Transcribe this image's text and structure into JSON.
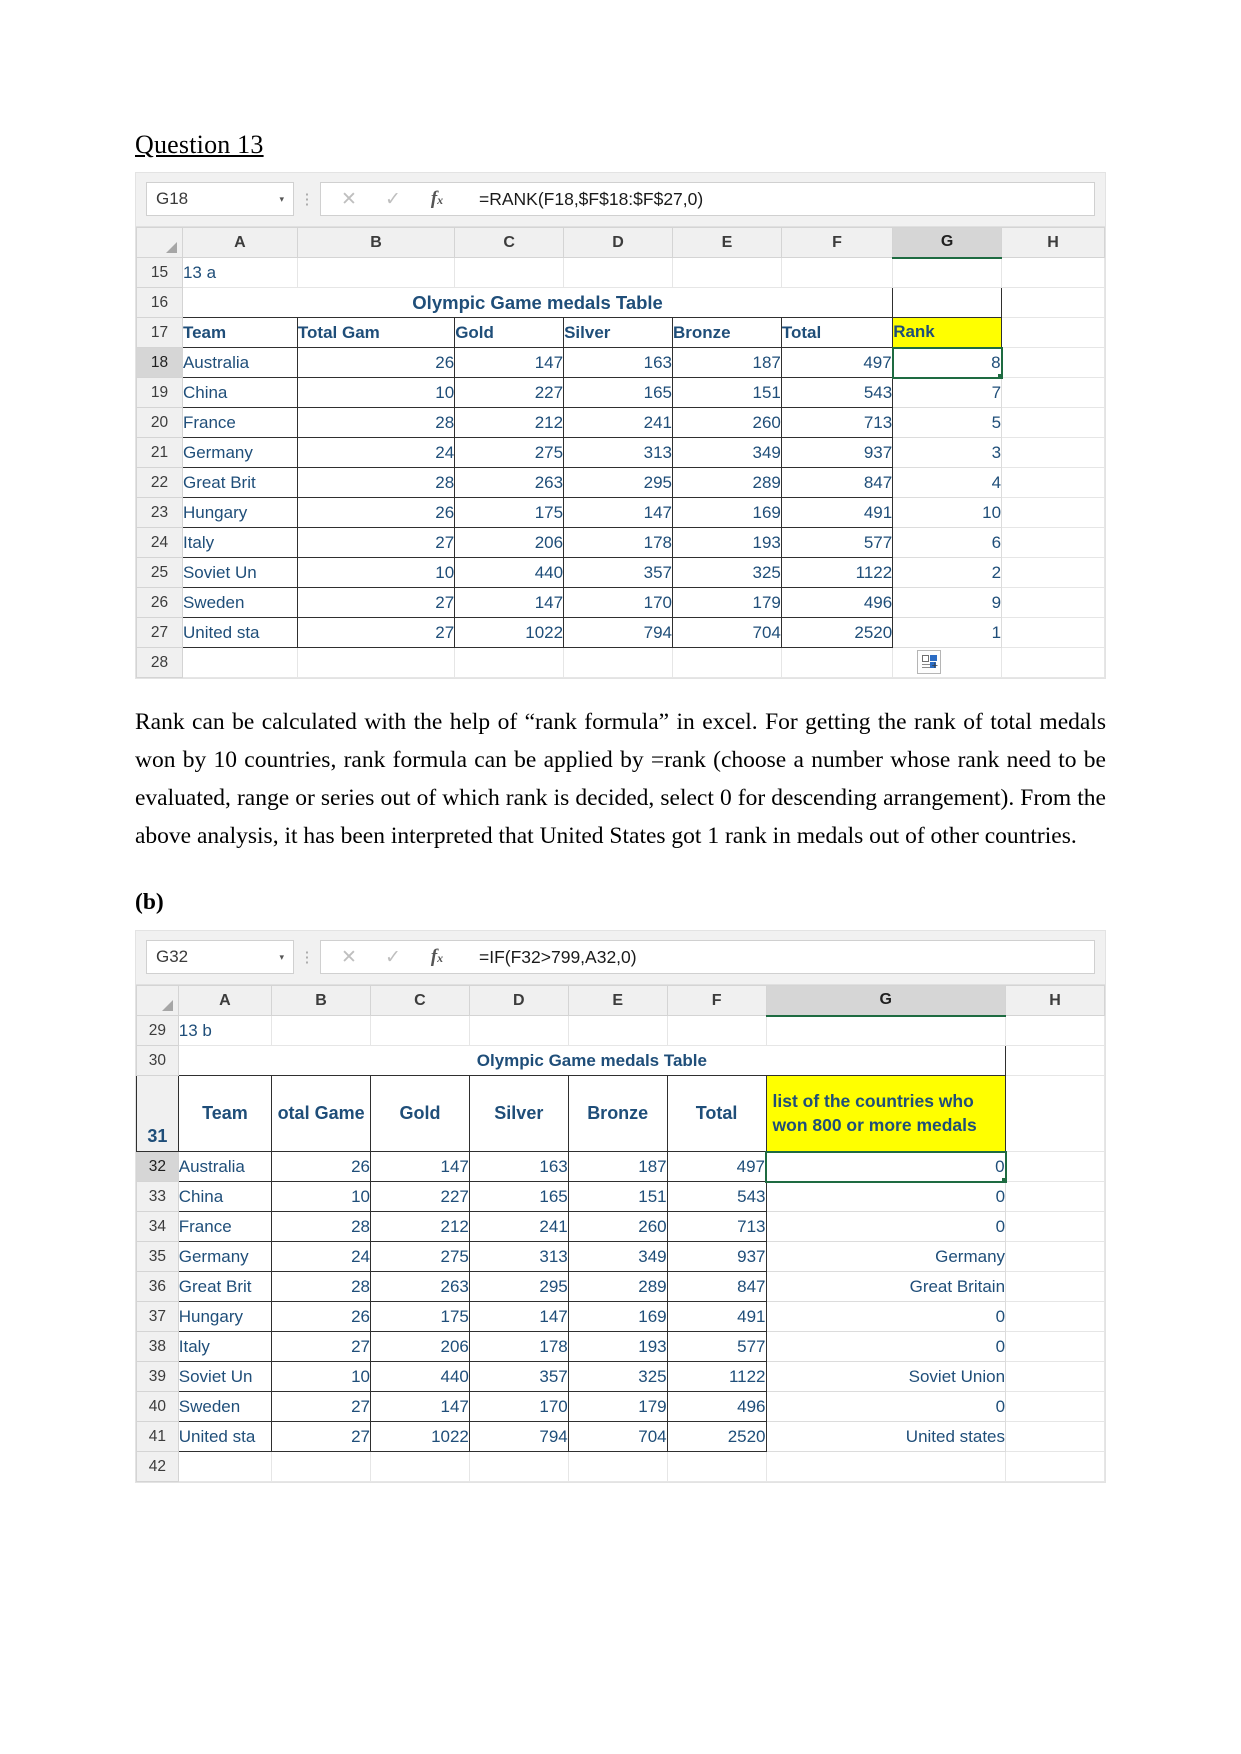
{
  "question_title": "Question 13",
  "sheet1": {
    "namebox": "G18",
    "namebox_caret": "▾",
    "menu_dots": "⋮",
    "cancel_icon": "✕",
    "confirm_icon": "✓",
    "fx_icon": "f",
    "fx_sub": "x",
    "formula": "=RANK(F18,$F$18:$F$27,0)",
    "columns": [
      "A",
      "B",
      "C",
      "D",
      "E",
      "F",
      "G",
      "H"
    ],
    "selected_column": "G",
    "rows": [
      "15",
      "16",
      "17",
      "18",
      "19",
      "20",
      "21",
      "22",
      "23",
      "24",
      "25",
      "26",
      "27",
      "28"
    ],
    "active_row": "18",
    "label_cell": "13 a",
    "table_title": "Olympic Game medals Table",
    "headers": [
      "Team",
      "Total Gam",
      "Gold",
      "Silver",
      "Bronze",
      "Total",
      "Rank"
    ],
    "highlight_header": "Rank",
    "data": [
      {
        "row": "18",
        "team": "Australia",
        "games": "26",
        "gold": "147",
        "silver": "163",
        "bronze": "187",
        "total": "497",
        "rank": "8"
      },
      {
        "row": "19",
        "team": "China",
        "games": "10",
        "gold": "227",
        "silver": "165",
        "bronze": "151",
        "total": "543",
        "rank": "7"
      },
      {
        "row": "20",
        "team": "France",
        "games": "28",
        "gold": "212",
        "silver": "241",
        "bronze": "260",
        "total": "713",
        "rank": "5"
      },
      {
        "row": "21",
        "team": "Germany",
        "games": "24",
        "gold": "275",
        "silver": "313",
        "bronze": "349",
        "total": "937",
        "rank": "3"
      },
      {
        "row": "22",
        "team": "Great Brit",
        "games": "28",
        "gold": "263",
        "silver": "295",
        "bronze": "289",
        "total": "847",
        "rank": "4"
      },
      {
        "row": "23",
        "team": "Hungary",
        "games": "26",
        "gold": "175",
        "silver": "147",
        "bronze": "169",
        "total": "491",
        "rank": "10"
      },
      {
        "row": "24",
        "team": "Italy",
        "games": "27",
        "gold": "206",
        "silver": "178",
        "bronze": "193",
        "total": "577",
        "rank": "6"
      },
      {
        "row": "25",
        "team": "Soviet Un",
        "games": "10",
        "gold": "440",
        "silver": "357",
        "bronze": "325",
        "total": "1122",
        "rank": "2"
      },
      {
        "row": "26",
        "team": "Sweden",
        "games": "27",
        "gold": "147",
        "silver": "170",
        "bronze": "179",
        "total": "496",
        "rank": "9"
      },
      {
        "row": "27",
        "team": "United sta",
        "games": "27",
        "gold": "1022",
        "silver": "794",
        "bronze": "704",
        "total": "2520",
        "rank": "1"
      }
    ],
    "last_row": "28",
    "autofill_plus": "+"
  },
  "paragraph": "Rank can be calculated with the help of “rank formula” in excel. For getting the rank of total medals won by 10 countries, rank formula can be applied by =rank (choose a number whose rank need to be evaluated, range or series out of which rank is decided, select 0 for descending arrangement). From the above analysis, it has been interpreted that United States got 1 rank in medals out of other countries.",
  "section_b_label": "(b)",
  "sheet2": {
    "namebox": "G32",
    "namebox_caret": "▾",
    "menu_dots": "⋮",
    "cancel_icon": "✕",
    "confirm_icon": "✓",
    "fx_icon": "f",
    "fx_sub": "x",
    "formula": "=IF(F32>799,A32,0)",
    "columns": [
      "A",
      "B",
      "C",
      "D",
      "E",
      "F",
      "G",
      "H"
    ],
    "selected_column": "G",
    "rows": [
      "29",
      "30",
      "31",
      "32",
      "33",
      "34",
      "35",
      "36",
      "37",
      "38",
      "39",
      "40",
      "41",
      "42"
    ],
    "active_row": "32",
    "label_cell": "13 b",
    "table_title": "Olympic Game medals Table",
    "headers": [
      "Team",
      "otal Game",
      "Gold",
      "Silver",
      "Bronze",
      "Total"
    ],
    "highlight_header": "list of the countries who won 800 or more medals",
    "data": [
      {
        "row": "32",
        "team": "Australia",
        "games": "26",
        "gold": "147",
        "silver": "163",
        "bronze": "187",
        "total": "497",
        "result": "0"
      },
      {
        "row": "33",
        "team": "China",
        "games": "10",
        "gold": "227",
        "silver": "165",
        "bronze": "151",
        "total": "543",
        "result": "0"
      },
      {
        "row": "34",
        "team": "France",
        "games": "28",
        "gold": "212",
        "silver": "241",
        "bronze": "260",
        "total": "713",
        "result": "0"
      },
      {
        "row": "35",
        "team": "Germany",
        "games": "24",
        "gold": "275",
        "silver": "313",
        "bronze": "349",
        "total": "937",
        "result": "Germany"
      },
      {
        "row": "36",
        "team": "Great Brit",
        "games": "28",
        "gold": "263",
        "silver": "295",
        "bronze": "289",
        "total": "847",
        "result": "Great Britain"
      },
      {
        "row": "37",
        "team": "Hungary",
        "games": "26",
        "gold": "175",
        "silver": "147",
        "bronze": "169",
        "total": "491",
        "result": "0"
      },
      {
        "row": "38",
        "team": "Italy",
        "games": "27",
        "gold": "206",
        "silver": "178",
        "bronze": "193",
        "total": "577",
        "result": "0"
      },
      {
        "row": "39",
        "team": "Soviet Un",
        "games": "10",
        "gold": "440",
        "silver": "357",
        "bronze": "325",
        "total": "1122",
        "result": "Soviet Union"
      },
      {
        "row": "40",
        "team": "Sweden",
        "games": "27",
        "gold": "147",
        "silver": "170",
        "bronze": "179",
        "total": "496",
        "result": "0"
      },
      {
        "row": "41",
        "team": "United sta",
        "games": "27",
        "gold": "1022",
        "silver": "794",
        "bronze": "704",
        "total": "2520",
        "result": "United states"
      }
    ],
    "last_row": "42"
  },
  "colors": {
    "cell_text": "#1f4e79",
    "highlight": "#ffff00",
    "selection": "#1e6b41",
    "header_bg": "#f0f0f0"
  }
}
